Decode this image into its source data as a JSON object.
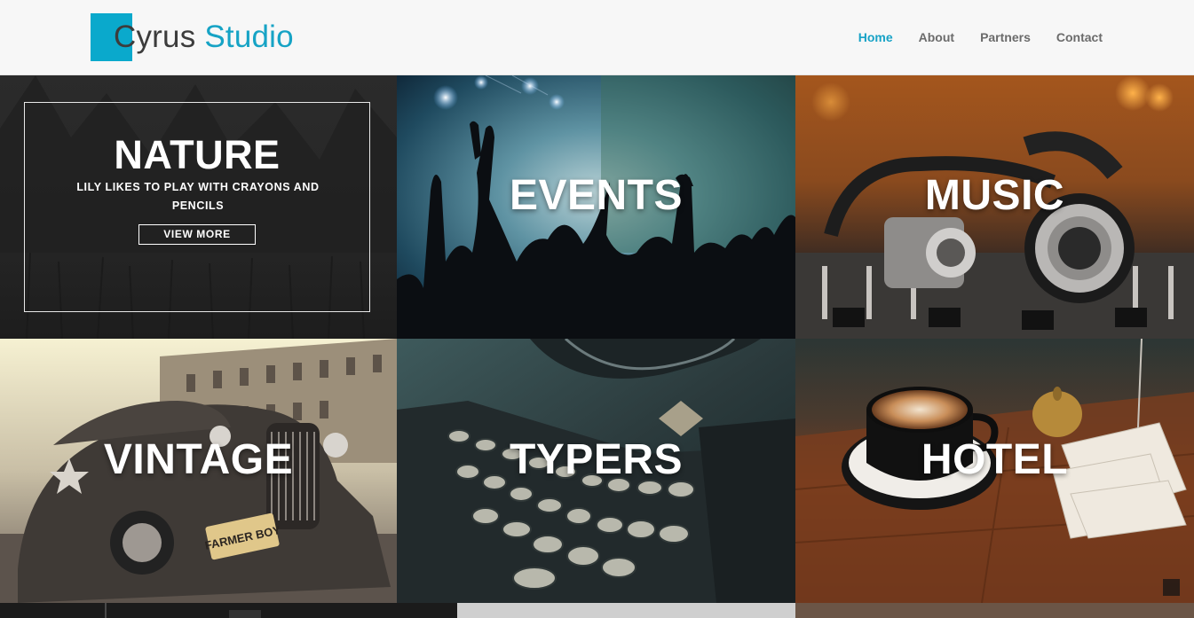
{
  "brand": {
    "first": "C",
    "rest": "yrus",
    "second": "Studio"
  },
  "nav": {
    "home": "Home",
    "about": "About",
    "partners": "Partners",
    "contact": "Contact"
  },
  "tiles": {
    "nature": {
      "title": "NATURE",
      "subtitle": "LILY LIKES TO PLAY WITH CRAYONS AND PENCILS",
      "button": "VIEW MORE"
    },
    "events": {
      "title": "EVENTS"
    },
    "music": {
      "title": "MUSIC"
    },
    "vintage": {
      "title": "VINTAGE"
    },
    "typers": {
      "title": "TYPERS"
    },
    "hotel": {
      "title": "HOTEL"
    }
  },
  "plate_text": "FARMER BOY",
  "colors": {
    "accent": "#17a2c6",
    "logo_square": "#0aa9cc",
    "nav_text": "#6b6b6b"
  }
}
